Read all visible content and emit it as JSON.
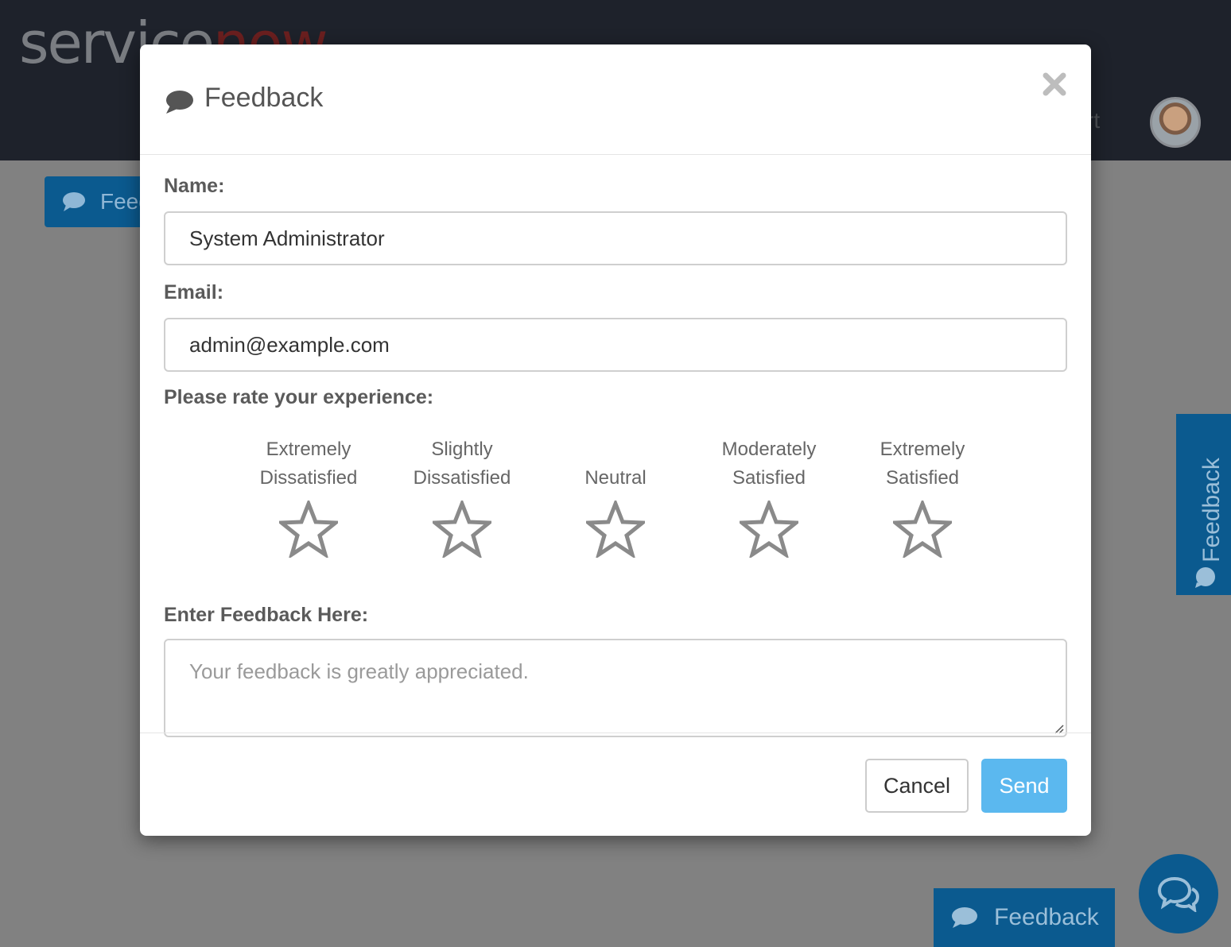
{
  "background": {
    "logo_service": "service",
    "logo_now": "now",
    "nav_fragment": "rt",
    "feedback_button_label": "Feed",
    "side_tab_label": "Feedback",
    "bottom_feedback_label": "Feedback"
  },
  "modal": {
    "title": "Feedback",
    "close_icon": "close-icon",
    "name": {
      "label": "Name:",
      "value": "System Administrator"
    },
    "email": {
      "label": "Email:",
      "value": "admin@example.com"
    },
    "rating": {
      "label": "Please rate your experience:",
      "options": [
        {
          "line1": "Extremely",
          "line2": "Dissatisfied"
        },
        {
          "line1": "Slightly",
          "line2": "Dissatisfied"
        },
        {
          "line1": "",
          "line2": "Neutral"
        },
        {
          "line1": "Moderately",
          "line2": "Satisfied"
        },
        {
          "line1": "Extremely",
          "line2": "Satisfied"
        }
      ],
      "selected": null
    },
    "feedback": {
      "label": "Enter Feedback Here:",
      "placeholder": "Your feedback is greatly appreciated.",
      "value": ""
    },
    "buttons": {
      "cancel": "Cancel",
      "send": "Send"
    }
  },
  "colors": {
    "primary": "#0b5a8f",
    "send_button": "#5bb8ef",
    "topbar": "#1e222b"
  }
}
